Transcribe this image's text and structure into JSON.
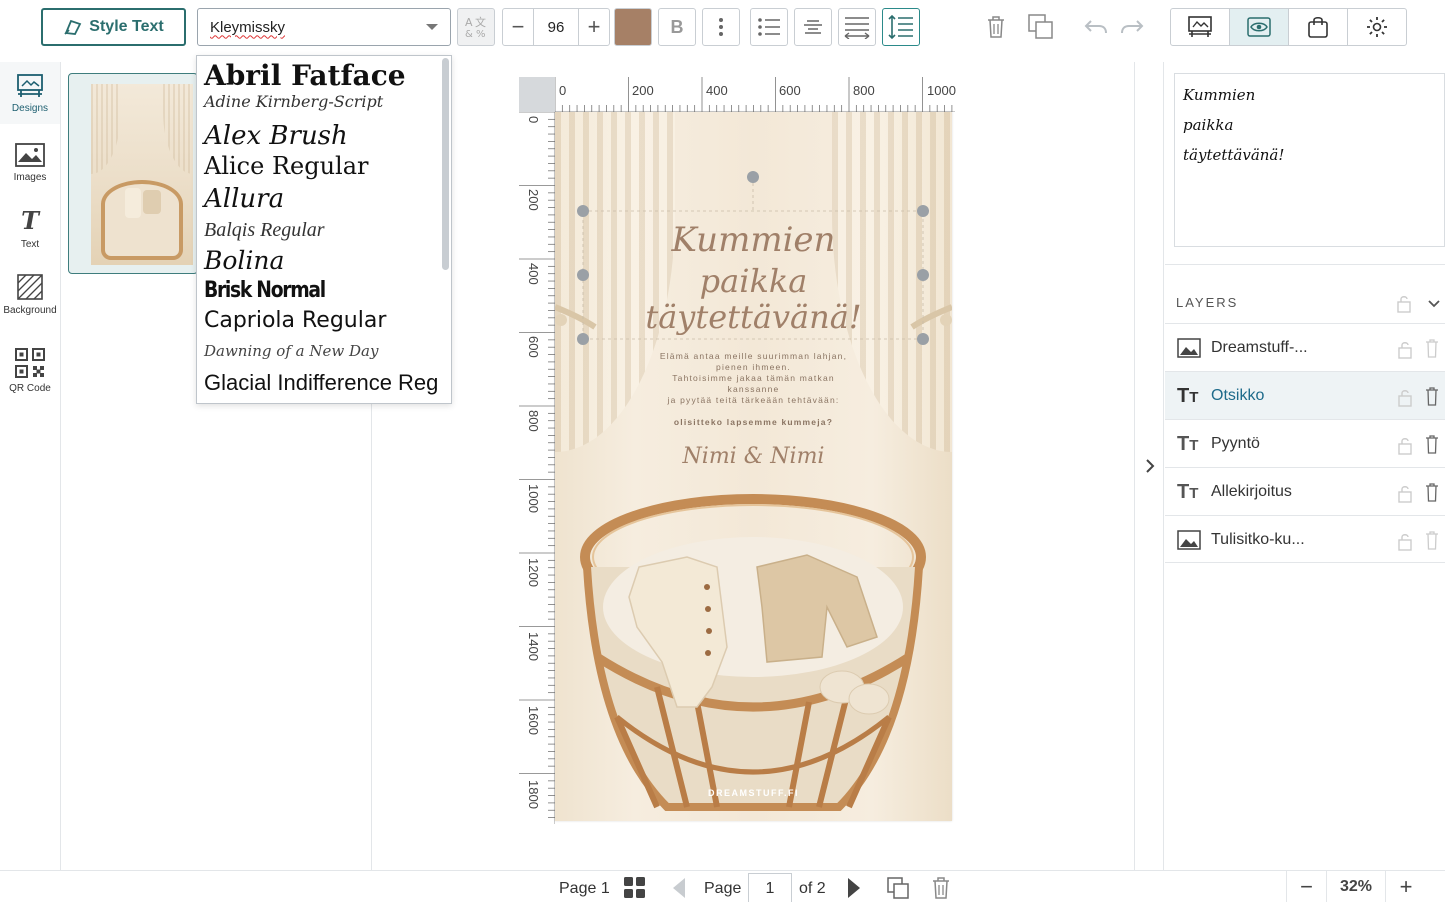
{
  "toolbar": {
    "style_text_label": "Style Text",
    "font_value": "Kleymissky",
    "font_size": "96",
    "text_color": "#a68066",
    "bold_label": "B"
  },
  "sidebar": {
    "items": [
      {
        "label": "Designs",
        "icon": "designs-icon"
      },
      {
        "label": "Images",
        "icon": "image-icon"
      },
      {
        "label": "Text",
        "icon": "text-icon"
      },
      {
        "label": "Background",
        "icon": "background-icon"
      },
      {
        "label": "QR Code",
        "icon": "qr-code-icon"
      }
    ]
  },
  "font_menu": {
    "options": [
      "Abril Fatface",
      "Adine Kirnberg-Script",
      "Alex Brush",
      "Alice Regular",
      "Allura",
      "Balqis Regular",
      "Bolina",
      "Brisk Normal",
      "Capriola Regular",
      "Dawning of a New Day",
      "Glacial Indifference Reg"
    ]
  },
  "ruler": {
    "top": [
      "0",
      "200",
      "400",
      "600",
      "800",
      "1000"
    ],
    "left": [
      "0",
      "200",
      "400",
      "600",
      "800",
      "1000",
      "1200",
      "1400",
      "1600",
      "1800"
    ]
  },
  "design": {
    "title_lines": [
      "Kummien",
      "paikka",
      "täytettävänä!"
    ],
    "body_lines": [
      "Elämä antaa meille suurimman lahjan,",
      "pienen ihmeen.",
      "Tahtoisimme jakaa tämän matkan",
      "kanssanne",
      "ja pyytää teitä tärkeään tehtävään:"
    ],
    "question": "olisitteko lapsemme kummeja?",
    "signature": "Nimi & Nimi",
    "watermark": "DREAMSTUFF.FI"
  },
  "right_panel": {
    "preview_lines": [
      "Kummien",
      "paikka",
      "täytettävänä!"
    ],
    "layers_title": "LAYERS",
    "layers": [
      {
        "name": "Dreamstuff-...",
        "type": "image",
        "active": false
      },
      {
        "name": "Otsikko",
        "type": "text",
        "active": true
      },
      {
        "name": "Pyyntö",
        "type": "text",
        "active": false
      },
      {
        "name": "Allekirjoitus",
        "type": "text",
        "active": false
      },
      {
        "name": "Tulisitko-ku...",
        "type": "image",
        "active": false
      }
    ]
  },
  "bottom": {
    "page_label": "Page 1",
    "page_word": "Page",
    "page_input": "1",
    "of_total": "of 2",
    "zoom": "32%"
  }
}
